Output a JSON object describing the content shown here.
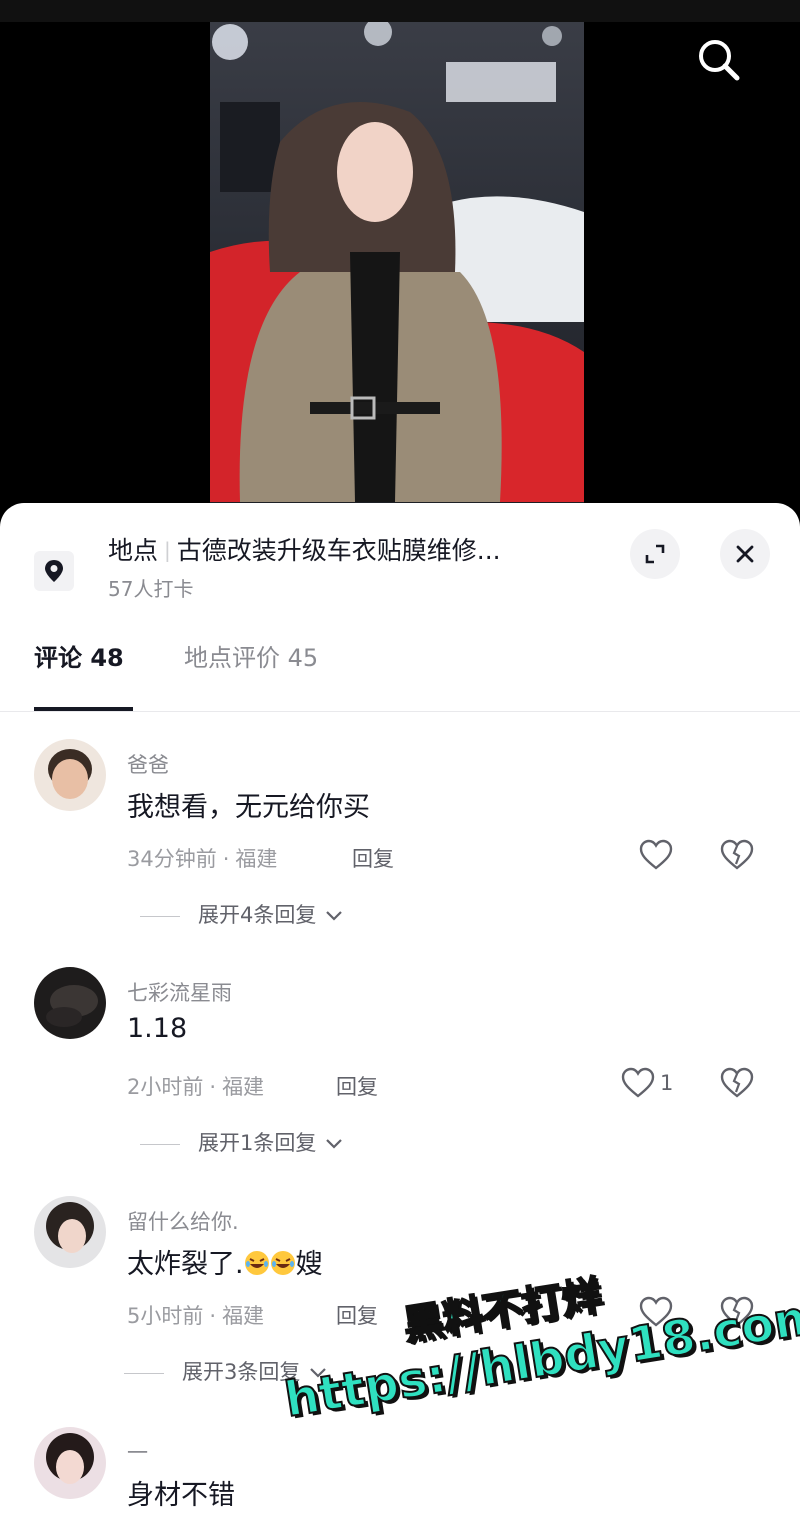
{
  "location": {
    "prefix": "地点",
    "name": "古德改装升级车衣贴膜维修...",
    "checkins": "57人打卡"
  },
  "tabs": {
    "comments": "评论 48",
    "reviews": "地点评价 45"
  },
  "comments": [
    {
      "user": "爸爸",
      "text": "我想看，无元给你买",
      "time": "34分钟前",
      "region": "福建",
      "reply": "回复",
      "likes": "",
      "expand": "展开4条回复"
    },
    {
      "user": "七彩流星雨",
      "text": "1.18",
      "time": "2小时前",
      "region": "福建",
      "reply": "回复",
      "likes": "1",
      "expand": "展开1条回复"
    },
    {
      "user": "留什么给你.",
      "text_before": "太炸裂了.",
      "text_after": "嫂",
      "time": "5小时前",
      "region": "福建",
      "reply": "回复",
      "likes": "",
      "expand": "展开3条回复"
    },
    {
      "user": "一",
      "text": "身材不错"
    }
  ],
  "meta_separator": "·",
  "watermark": {
    "line1": "黑料不打烊",
    "line2": "https://hlbdy18.com"
  },
  "icons": [
    "search-icon",
    "location-pin-icon",
    "expand-icon",
    "close-icon",
    "heart-icon",
    "broken-heart-icon",
    "chevron-down-icon",
    "laughing-emoji-icon"
  ],
  "colors": {
    "primary_text": "#161823",
    "secondary_text": "#8a8b91",
    "watermark": "#2fe0c0"
  }
}
